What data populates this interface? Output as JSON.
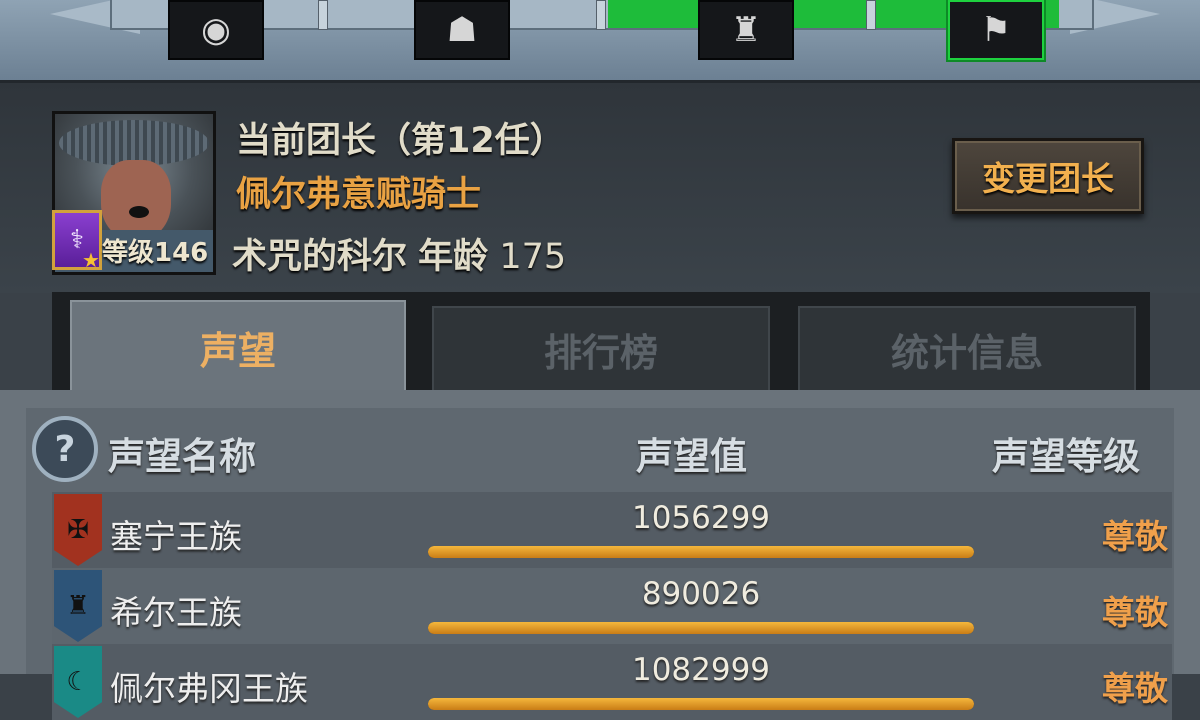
{
  "nav": {
    "icons": [
      {
        "name": "eye-icon",
        "glyph": "◉"
      },
      {
        "name": "hooded-figure-icon",
        "glyph": "☗"
      },
      {
        "name": "crossed-arms-figure-icon",
        "glyph": "♜"
      },
      {
        "name": "burning-flag-icon",
        "glyph": "⚑"
      }
    ],
    "progress_fraction": 0.46
  },
  "leader": {
    "title": "当前团长（第12任）",
    "name": "佩尔弗意赋骑士",
    "level_label": "等级146",
    "hero_name": "术咒的科尔",
    "age_label": "年龄",
    "age": "175",
    "change_button": "变更团长",
    "class_icon": "staff-icon"
  },
  "tabs": [
    {
      "label": "声望",
      "active": true
    },
    {
      "label": "排行榜",
      "active": false
    },
    {
      "label": "统计信息",
      "active": false
    }
  ],
  "reputation": {
    "help_label": "?",
    "headers": {
      "name": "声望名称",
      "value": "声望值",
      "level": "声望等级"
    },
    "rows": [
      {
        "name": "塞宁王族",
        "value": "1056299",
        "level": "尊敬",
        "bar_fraction": 1.0,
        "crest_color": "#a2321f",
        "crest_glyph": "✠"
      },
      {
        "name": "希尔王族",
        "value": "890026",
        "level": "尊敬",
        "bar_fraction": 1.0,
        "crest_color": "#2d5478",
        "crest_glyph": "♜"
      },
      {
        "name": "佩尔弗冈王族",
        "value": "1082999",
        "level": "尊敬",
        "bar_fraction": 1.0,
        "crest_color": "#1a8a86",
        "crest_glyph": "☾"
      }
    ]
  },
  "colors": {
    "accent_orange": "#e9a243",
    "progress_green": "#1ebc3a"
  }
}
